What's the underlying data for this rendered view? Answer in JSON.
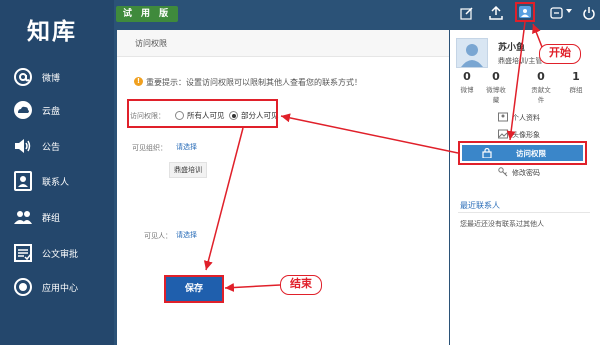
{
  "app": {
    "logo": "知库",
    "trial_badge": "试 用 版"
  },
  "sidebar": {
    "items": [
      {
        "label": "微博",
        "icon": "at-sign-icon"
      },
      {
        "label": "云盘",
        "icon": "cloud-icon"
      },
      {
        "label": "公告",
        "icon": "speaker-icon"
      },
      {
        "label": "联系人",
        "icon": "contact-card-icon"
      },
      {
        "label": "群组",
        "icon": "group-icon"
      },
      {
        "label": "公文审批",
        "icon": "approval-doc-icon"
      },
      {
        "label": "应用中心",
        "icon": "app-center-icon"
      }
    ]
  },
  "topbar": {
    "icons": [
      "edit-icon",
      "upload-icon",
      "profile-icon",
      "message-icon",
      "power-icon"
    ]
  },
  "main": {
    "breadcrumb": "访问权限",
    "tip": "重要提示：设置访问权限可以限制其他人查看您的联系方式！",
    "access_label": "访问权限：",
    "option_all": "所有人可见",
    "option_some": "部分人可见",
    "selected_option": "部分人可见",
    "visible_org_label": "可见组织：",
    "select_link_1": "请选择",
    "org_tag": "鼎盛培训",
    "visible_people_label": "可见人：",
    "select_link_2": "请选择",
    "save_label": "保存"
  },
  "profile": {
    "name": "苏小鱼",
    "org": "鼎盛培训/主管",
    "stats": [
      {
        "value": "0",
        "label": "微博"
      },
      {
        "value": "0",
        "label": "微博收藏"
      },
      {
        "value": "0",
        "label": "贡献文件"
      },
      {
        "value": "1",
        "label": "群组"
      }
    ],
    "menu": [
      {
        "label": "个人资料",
        "icon": "profile-card-icon"
      },
      {
        "label": "头像形象",
        "icon": "avatar-image-icon"
      },
      {
        "label": "访问权限",
        "icon": "lock-icon"
      },
      {
        "label": "修改密码",
        "icon": "key-icon"
      }
    ],
    "recent_title": "最近联系人",
    "recent_empty": "您最近还没有联系过其他人"
  },
  "annotations": {
    "start_label": "开始",
    "end_label": "结束",
    "color": "#e0202a"
  },
  "colors": {
    "sidebar": "#24476c",
    "topbar": "#2b5277",
    "trial": "#3f8a3c",
    "active_menu": "#3a86c9",
    "save_button": "#1f5fad",
    "annotation": "#e0202a"
  }
}
